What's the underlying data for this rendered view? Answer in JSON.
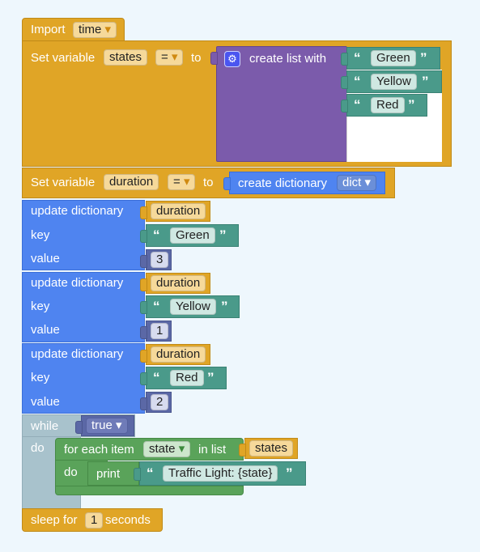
{
  "import_block": {
    "label": "Import",
    "module": "time"
  },
  "set_states": {
    "label": "Set variable",
    "name": "states",
    "op": "=",
    "to": "to",
    "list_label": "create list with",
    "items": [
      "Green",
      "Yellow",
      "Red"
    ]
  },
  "set_duration": {
    "label": "Set variable",
    "name": "duration",
    "op": "=",
    "to": "to",
    "dict_label": "create dictionary",
    "dict_type": "dict"
  },
  "updates": [
    {
      "title": "update dictionary",
      "target": "duration",
      "key_label": "key",
      "key": "Green",
      "value_label": "value",
      "value": "3"
    },
    {
      "title": "update dictionary",
      "target": "duration",
      "key_label": "key",
      "key": "Yellow",
      "value_label": "value",
      "value": "1"
    },
    {
      "title": "update dictionary",
      "target": "duration",
      "key_label": "key",
      "key": "Red",
      "value_label": "value",
      "value": "2"
    }
  ],
  "while_block": {
    "label": "while",
    "cond": "true",
    "do": "do"
  },
  "for_each": {
    "label": "for each item",
    "var": "state",
    "in_list": "in list",
    "list": "states",
    "do": "do"
  },
  "print_block": {
    "label": "print",
    "text": "Traffic Light: {state}"
  },
  "sleep_block": {
    "label1": "sleep for",
    "value": "1",
    "label2": "seconds"
  },
  "glyphs": {
    "open_quote": "“",
    "close_quote": "”",
    "dropdown": "▾",
    "gear": "⚙"
  }
}
